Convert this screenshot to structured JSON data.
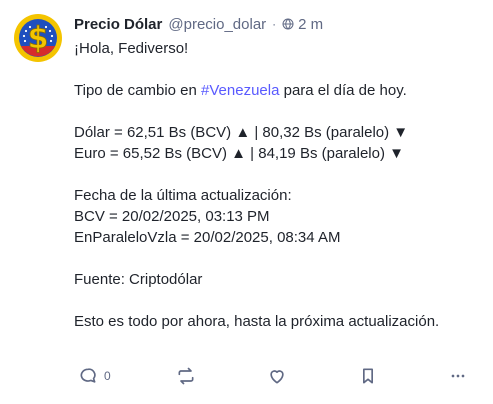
{
  "post": {
    "author": {
      "display_name": "Precio Dólar",
      "handle": "@precio_dolar",
      "separator": "·",
      "visibility_icon": "globe-icon",
      "time": "2 m",
      "avatar_colors": {
        "outer": "#f4c400",
        "inner": "#1f4fbf",
        "symbol": "#f4c400",
        "bottom": "#d62c2c",
        "stars": "#ffffff"
      }
    },
    "content": {
      "greeting": "¡Hola, Fediverso!",
      "intro_before": "Tipo de cambio en ",
      "hashtag": "#Venezuela",
      "intro_after": " para el día de hoy.",
      "dolar_line": "Dólar = 62,51 Bs (BCV) ▲ | 80,32 Bs (paralelo) ▼",
      "euro_line": "Euro = 65,52 Bs (BCV) ▲ | 84,19 Bs (paralelo) ▼",
      "update_title": "Fecha de la última actualización:",
      "bcv_update": "BCV = 20/02/2025, 03:13 PM",
      "paralelo_update": "EnParaleloVzla = 20/02/2025, 08:34 AM",
      "source": "Fuente: Criptodólar",
      "closing": "Esto es todo por ahora, hasta la próxima actualización."
    },
    "actions": {
      "reply_icon": "reply-icon",
      "reply_count": "0",
      "boost_icon": "boost-icon",
      "favourite_icon": "star-icon",
      "bookmark_icon": "bookmark-icon",
      "more_icon": "more-icon"
    },
    "colors": {
      "accent": "#595aff",
      "muted": "#606984",
      "text": "#1f232b"
    }
  }
}
